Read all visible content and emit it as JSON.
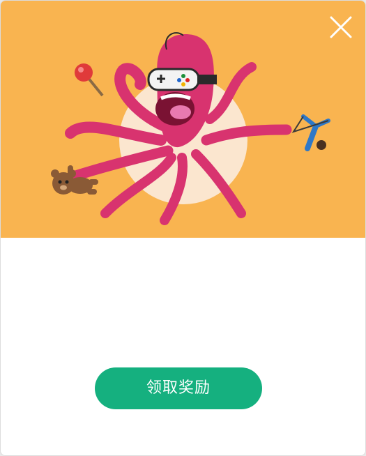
{
  "dialog": {
    "banner_color": "#f9b450",
    "illustration": "octopus-gamer-illustration",
    "close_icon": "close-icon",
    "claim_button_label": "领取奖励",
    "claim_button_color": "#15b07f"
  }
}
